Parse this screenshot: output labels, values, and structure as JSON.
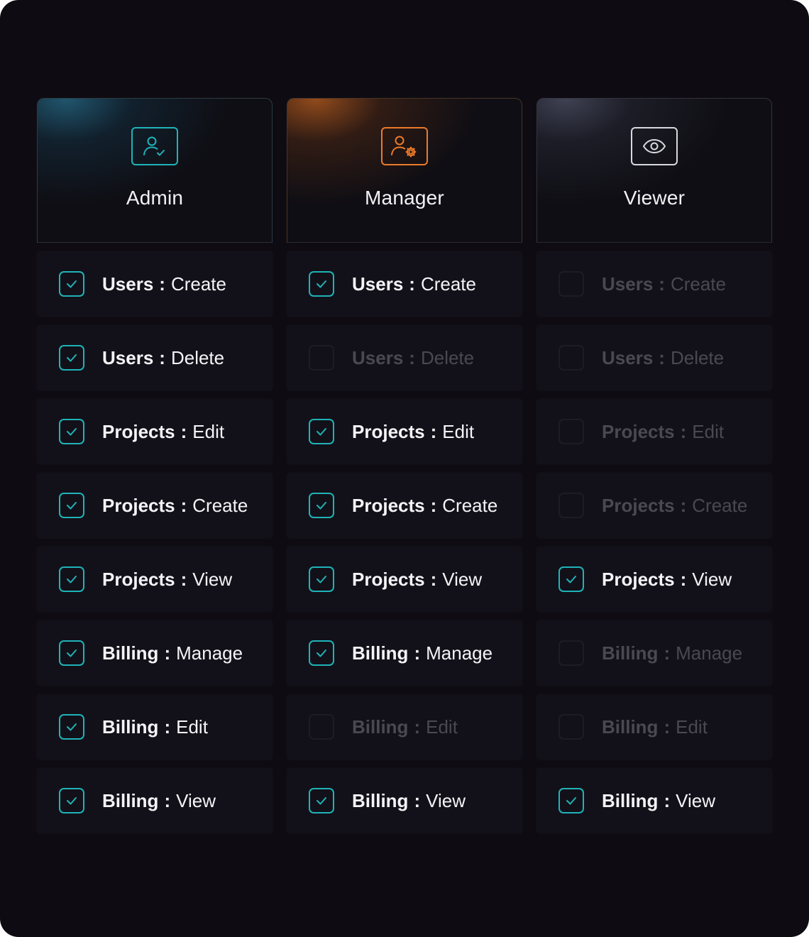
{
  "colors": {
    "accent_teal": "#1fb3b8",
    "accent_orange": "#ec7a2a",
    "neutral_light": "#d8d8de",
    "background": "#0e0c12",
    "row_background": "#121119",
    "disabled_text": "#4a4852"
  },
  "roles": [
    {
      "name": "Admin",
      "icon": "user-check-icon",
      "permissions": [
        {
          "resource": "Users",
          "separator": ":",
          "action": "Create",
          "checked": true
        },
        {
          "resource": "Users",
          "separator": ":",
          "action": "Delete",
          "checked": true
        },
        {
          "resource": "Projects",
          "separator": ":",
          "action": "Edit",
          "checked": true
        },
        {
          "resource": "Projects",
          "separator": ":",
          "action": "Create",
          "checked": true
        },
        {
          "resource": "Projects",
          "separator": ":",
          "action": "View",
          "checked": true
        },
        {
          "resource": "Billing",
          "separator": ":",
          "action": "Manage",
          "checked": true
        },
        {
          "resource": "Billing",
          "separator": ":",
          "action": "Edit",
          "checked": true
        },
        {
          "resource": "Billing",
          "separator": ":",
          "action": "View",
          "checked": true
        }
      ]
    },
    {
      "name": "Manager",
      "icon": "user-settings-icon",
      "permissions": [
        {
          "resource": "Users",
          "separator": ":",
          "action": "Create",
          "checked": true
        },
        {
          "resource": "Users",
          "separator": ":",
          "action": "Delete",
          "checked": false
        },
        {
          "resource": "Projects",
          "separator": ":",
          "action": "Edit",
          "checked": true
        },
        {
          "resource": "Projects",
          "separator": ":",
          "action": "Create",
          "checked": true
        },
        {
          "resource": "Projects",
          "separator": ":",
          "action": "View",
          "checked": true
        },
        {
          "resource": "Billing",
          "separator": ":",
          "action": "Manage",
          "checked": true
        },
        {
          "resource": "Billing",
          "separator": ":",
          "action": "Edit",
          "checked": false
        },
        {
          "resource": "Billing",
          "separator": ":",
          "action": "View",
          "checked": true
        }
      ]
    },
    {
      "name": "Viewer",
      "icon": "eye-icon",
      "permissions": [
        {
          "resource": "Users",
          "separator": ":",
          "action": "Create",
          "checked": false
        },
        {
          "resource": "Users",
          "separator": ":",
          "action": "Delete",
          "checked": false
        },
        {
          "resource": "Projects",
          "separator": ":",
          "action": "Edit",
          "checked": false
        },
        {
          "resource": "Projects",
          "separator": ":",
          "action": "Create",
          "checked": false
        },
        {
          "resource": "Projects",
          "separator": ":",
          "action": "View",
          "checked": true
        },
        {
          "resource": "Billing",
          "separator": ":",
          "action": "Manage",
          "checked": false
        },
        {
          "resource": "Billing",
          "separator": ":",
          "action": "Edit",
          "checked": false
        },
        {
          "resource": "Billing",
          "separator": ":",
          "action": "View",
          "checked": true
        }
      ]
    }
  ]
}
